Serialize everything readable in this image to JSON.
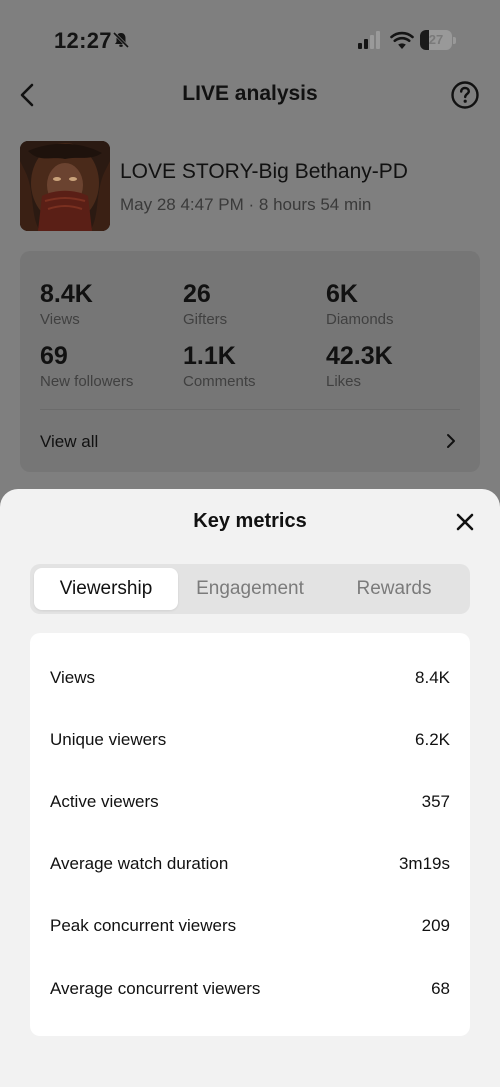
{
  "status_bar": {
    "time": "12:27",
    "battery_level": "27",
    "battery_fraction": 0.27
  },
  "header": {
    "title": "LIVE analysis",
    "back_icon": "chevron-left-icon",
    "help_icon": "question-circle-icon"
  },
  "live": {
    "title": "LOVE STORY-Big Bethany-PD",
    "meta": "May 28 4:47 PM · 8 hours 54 min"
  },
  "stats": [
    {
      "value": "8.4K",
      "label": "Views"
    },
    {
      "value": "26",
      "label": "Gifters"
    },
    {
      "value": "6K",
      "label": "Diamonds"
    },
    {
      "value": "69",
      "label": "New followers"
    },
    {
      "value": "1.1K",
      "label": "Comments"
    },
    {
      "value": "42.3K",
      "label": "Likes"
    }
  ],
  "view_all": {
    "label": "View all"
  },
  "sheet": {
    "title": "Key metrics",
    "tabs": [
      {
        "label": "Viewership",
        "active": true
      },
      {
        "label": "Engagement",
        "active": false
      },
      {
        "label": "Rewards",
        "active": false
      }
    ],
    "metrics": [
      {
        "label": "Views",
        "value": "8.4K"
      },
      {
        "label": "Unique viewers",
        "value": "6.2K"
      },
      {
        "label": "Active viewers",
        "value": "357"
      },
      {
        "label": "Average watch duration",
        "value": "3m19s"
      },
      {
        "label": "Peak concurrent viewers",
        "value": "209"
      },
      {
        "label": "Average concurrent viewers",
        "value": "68"
      }
    ]
  },
  "colors": {
    "overlay_background": "#808080",
    "sheet_background": "#f2f2f2",
    "card_background": "#ffffff",
    "text_primary": "#111111",
    "tab_inactive": "#7b7b7b"
  }
}
